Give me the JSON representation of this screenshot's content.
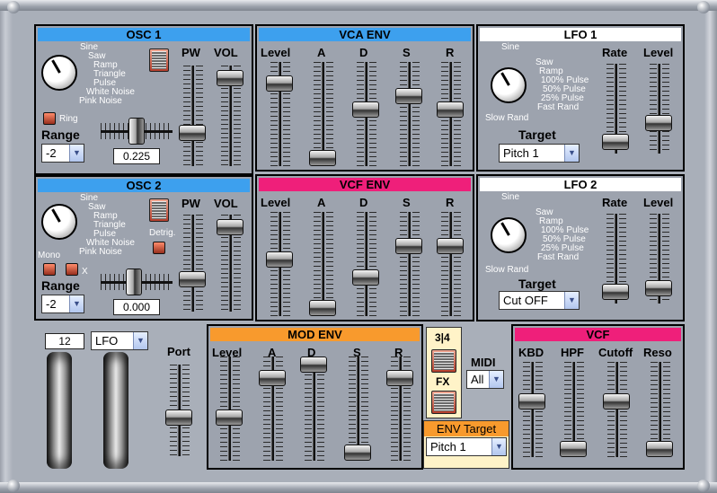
{
  "osc1": {
    "title": "OSC 1",
    "waves": [
      "Sine",
      "Saw",
      "Ramp",
      "Triangle",
      "Pulse",
      "White Noise",
      "Pink Noise"
    ],
    "ring_label": "Ring",
    "range_label": "Range",
    "range_value": "-2",
    "tune_value": "0.225",
    "pw_label": "PW",
    "vol_label": "VOL"
  },
  "osc2": {
    "title": "OSC 2",
    "waves": [
      "Sine",
      "Saw",
      "Ramp",
      "Triangle",
      "Pulse",
      "White Noise",
      "Pink Noise"
    ],
    "detrig_label": "Detrig.",
    "mono_label": "Mono",
    "x_label": "X",
    "range_label": "Range",
    "range_value": "-2",
    "tune_value": "0.000",
    "pw_label": "PW",
    "vol_label": "VOL"
  },
  "vca_env": {
    "title": "VCA ENV",
    "sliders": [
      "Level",
      "A",
      "D",
      "S",
      "R"
    ]
  },
  "vcf_env": {
    "title": "VCF ENV",
    "sliders": [
      "Level",
      "A",
      "D",
      "S",
      "R"
    ]
  },
  "lfo1": {
    "title": "LFO 1",
    "waves": [
      "Sine",
      "Saw",
      "Ramp",
      "100% Pulse",
      "50% Pulse",
      "25% Pulse",
      "Fast Rand",
      "Slow Rand"
    ],
    "rate_label": "Rate",
    "level_label": "Level",
    "target_label": "Target",
    "target_value": "Pitch 1"
  },
  "lfo2": {
    "title": "LFO 2",
    "waves": [
      "Sine",
      "Saw",
      "Ramp",
      "100% Pulse",
      "50% Pulse",
      "25% Pulse",
      "Fast Rand",
      "Slow Rand"
    ],
    "rate_label": "Rate",
    "level_label": "Level",
    "target_label": "Target",
    "target_value": "Cut OFF"
  },
  "mod_env": {
    "title": "MOD ENV",
    "sliders": [
      "Level",
      "A",
      "D",
      "S",
      "R"
    ]
  },
  "perf": {
    "bend_value": "12",
    "mod_source": "LFO",
    "port_label": "Port"
  },
  "misc": {
    "ratio_label": "3|4",
    "fx_label": "FX",
    "midi_label": "MIDI",
    "midi_value": "All",
    "env_target_title": "ENV Target",
    "env_target_value": "Pitch 1"
  },
  "vcf": {
    "title": "VCF",
    "sliders": [
      "KBD",
      "HPF",
      "Cutoff",
      "Reso"
    ]
  },
  "levels": {
    "osc1_pw": 0.3,
    "osc1_vol": 0.95,
    "osc2_pw": 0.3,
    "osc2_vol": 0.95,
    "vca_env": [
      0.85,
      0.0,
      0.55,
      0.7,
      0.55
    ],
    "vcf_env": [
      0.55,
      0.0,
      0.35,
      0.7,
      0.7
    ],
    "lfo1_rate": 0.05,
    "lfo1_level": 0.3,
    "lfo2_rate": 0.05,
    "lfo2_level": 0.1,
    "mod_env": [
      0.4,
      0.85,
      1.0,
      0.0,
      0.85
    ],
    "port": 0.4,
    "vcf": [
      0.6,
      0.0,
      0.6,
      0.0
    ],
    "osc1_tune": 0.5,
    "osc2_tune": 0.45,
    "osc1_wave": 0.0,
    "osc2_wave": 0.0,
    "lfo1_wave": 0.0,
    "lfo2_wave": 0.0
  },
  "colors": {
    "osc_header": "#3da0ee",
    "env_header_vca": "#3da0ee",
    "env_header_vcf": "#ef1f7a",
    "lfo_header": "#ffffff",
    "mod_header": "#f89a2d",
    "vcf_header": "#ef1f7a",
    "panel": "#9da3ae",
    "misc_panel": "#fff3c8"
  }
}
